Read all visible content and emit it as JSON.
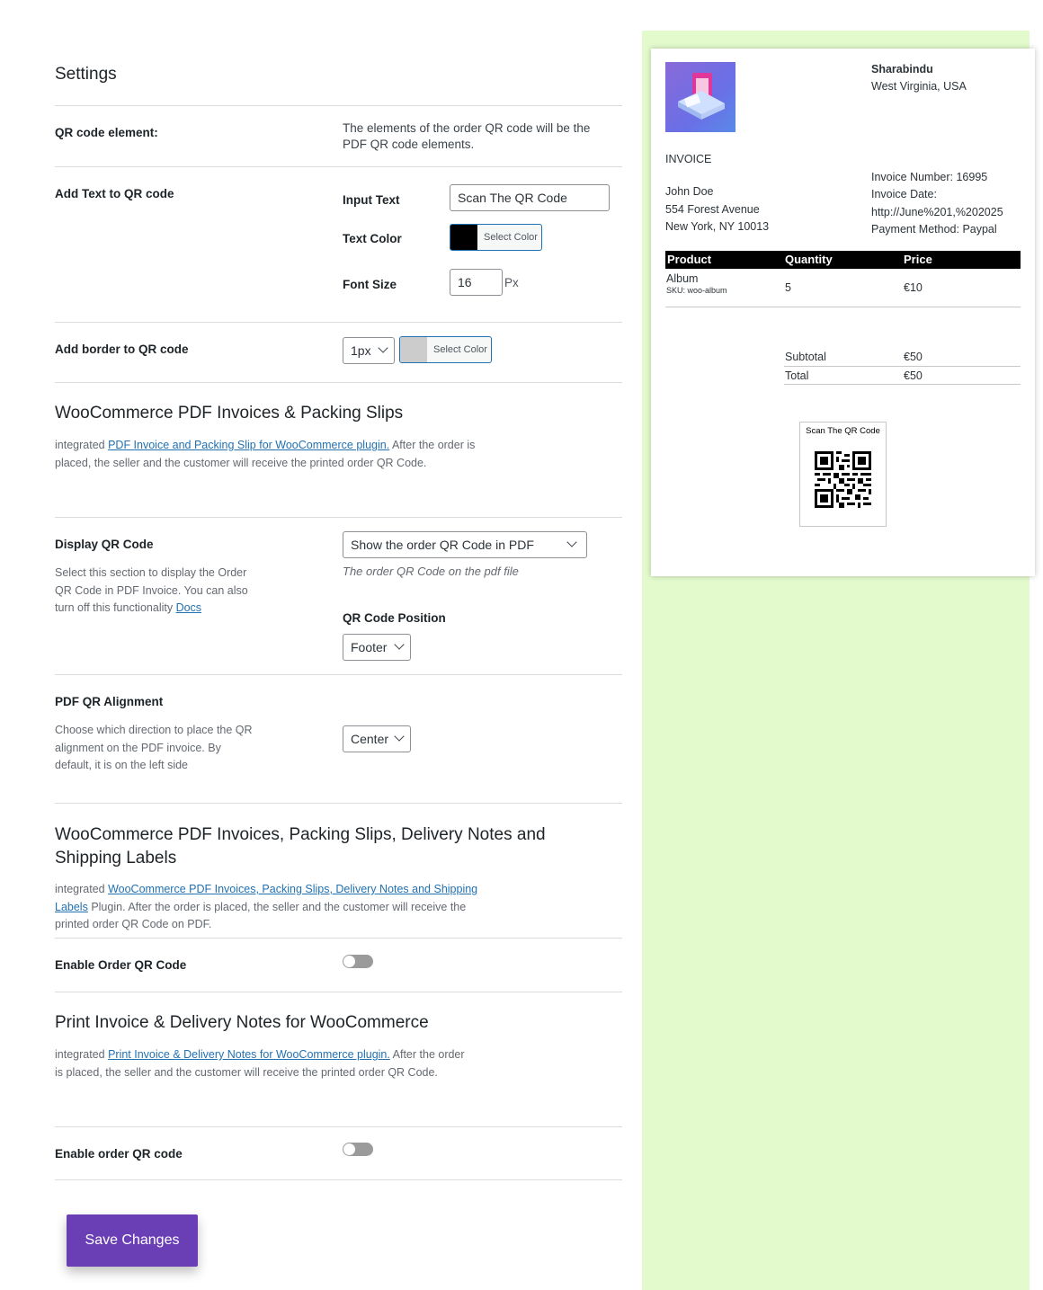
{
  "settings": {
    "title": "Settings",
    "qr_element": {
      "label": "QR code element:",
      "description": "The elements of the order QR code will be the PDF QR code elements."
    },
    "add_text": {
      "label": "Add Text to QR code",
      "input_text_label": "Input Text",
      "input_text_value": "Scan The QR Code",
      "text_color_label": "Text Color",
      "text_color_value": "#000000",
      "select_color": "Select Color",
      "font_size_label": "Font Size",
      "font_size_value": "16",
      "font_size_unit": "Px"
    },
    "add_border": {
      "label": "Add border to QR code",
      "width_value": "1px",
      "border_color_value": "#cccccc",
      "select_color": "Select Color"
    }
  },
  "woo_pdf": {
    "title": "WooCommerce PDF Invoices & Packing Slips",
    "desc_prefix": "integrated ",
    "desc_link": "PDF Invoice and Packing Slip for WooCommerce plugin.",
    "desc_suffix_1": " After the order is",
    "desc_suffix_2": "placed, the seller and the customer will receive the printed order QR Code.",
    "display": {
      "label": "Display QR Code",
      "desc_1": "Select this section to display the Order",
      "desc_2": "QR Code in PDF Invoice. You can also",
      "desc_3": "turn off this functionality ",
      "desc_link": "Docs",
      "select_value": "Show the order QR Code in PDF",
      "hint": "The order QR Code on the pdf file",
      "position_label": "QR Code Position",
      "position_value": "Footer"
    },
    "alignment": {
      "label": "PDF QR Alignment",
      "desc_1": "Choose which direction to place the QR",
      "desc_2": "alignment on the PDF invoice. By",
      "desc_3": "default, it is on the left side",
      "value": "Center"
    }
  },
  "woo_pdf_delivery": {
    "title_1": "WooCommerce PDF Invoices, Packing Slips, Delivery Notes and",
    "title_2": "Shipping Labels",
    "desc_prefix": "integrated ",
    "desc_link_1": "WooCommerce PDF Invoices, Packing Slips, Delivery Notes and Shipping",
    "desc_link_2": "Labels",
    "desc_suffix_1": " Plugin. After the order is placed, the seller and the customer will receive the",
    "desc_suffix_2": "printed order QR Code on PDF.",
    "enable_label": "Enable Order QR Code"
  },
  "print_invoice": {
    "title": "Print Invoice & Delivery Notes for WooCommerce",
    "desc_prefix": "integrated ",
    "desc_link": "Print Invoice & Delivery Notes for WooCommerce plugin.",
    "desc_suffix_1": " After the order",
    "desc_suffix_2": "is placed, the seller and the customer will receive the printed order QR Code.",
    "enable_label": "Enable order QR code"
  },
  "save_label": "Save Changes",
  "preview": {
    "shop_name": "Sharabindu",
    "shop_location": "West Virginia, USA",
    "invoice_title": "INVOICE",
    "invoice_number": "Invoice Number: 16995",
    "invoice_date_label": "Invoice Date:",
    "invoice_date_value": "http://June%201,%202025",
    "payment_method": "Payment Method: Paypal",
    "customer_name": "John Doe",
    "customer_street": "554 Forest Avenue",
    "customer_city": "New York, NY 10013",
    "table_headers": [
      "Product",
      "Quantity",
      "Price"
    ],
    "item": {
      "name": "Album",
      "sku": "SKU: woo-album",
      "quantity": "5",
      "price": "€10"
    },
    "subtotal_label": "Subtotal",
    "subtotal_value": "€50",
    "total_label": "Total",
    "total_value": "€50",
    "qr_caption": "Scan The QR Code"
  },
  "colors": {
    "accent": "#6a3fb5",
    "preview_bg": "#e3fbcc",
    "link": "#2271b1"
  }
}
